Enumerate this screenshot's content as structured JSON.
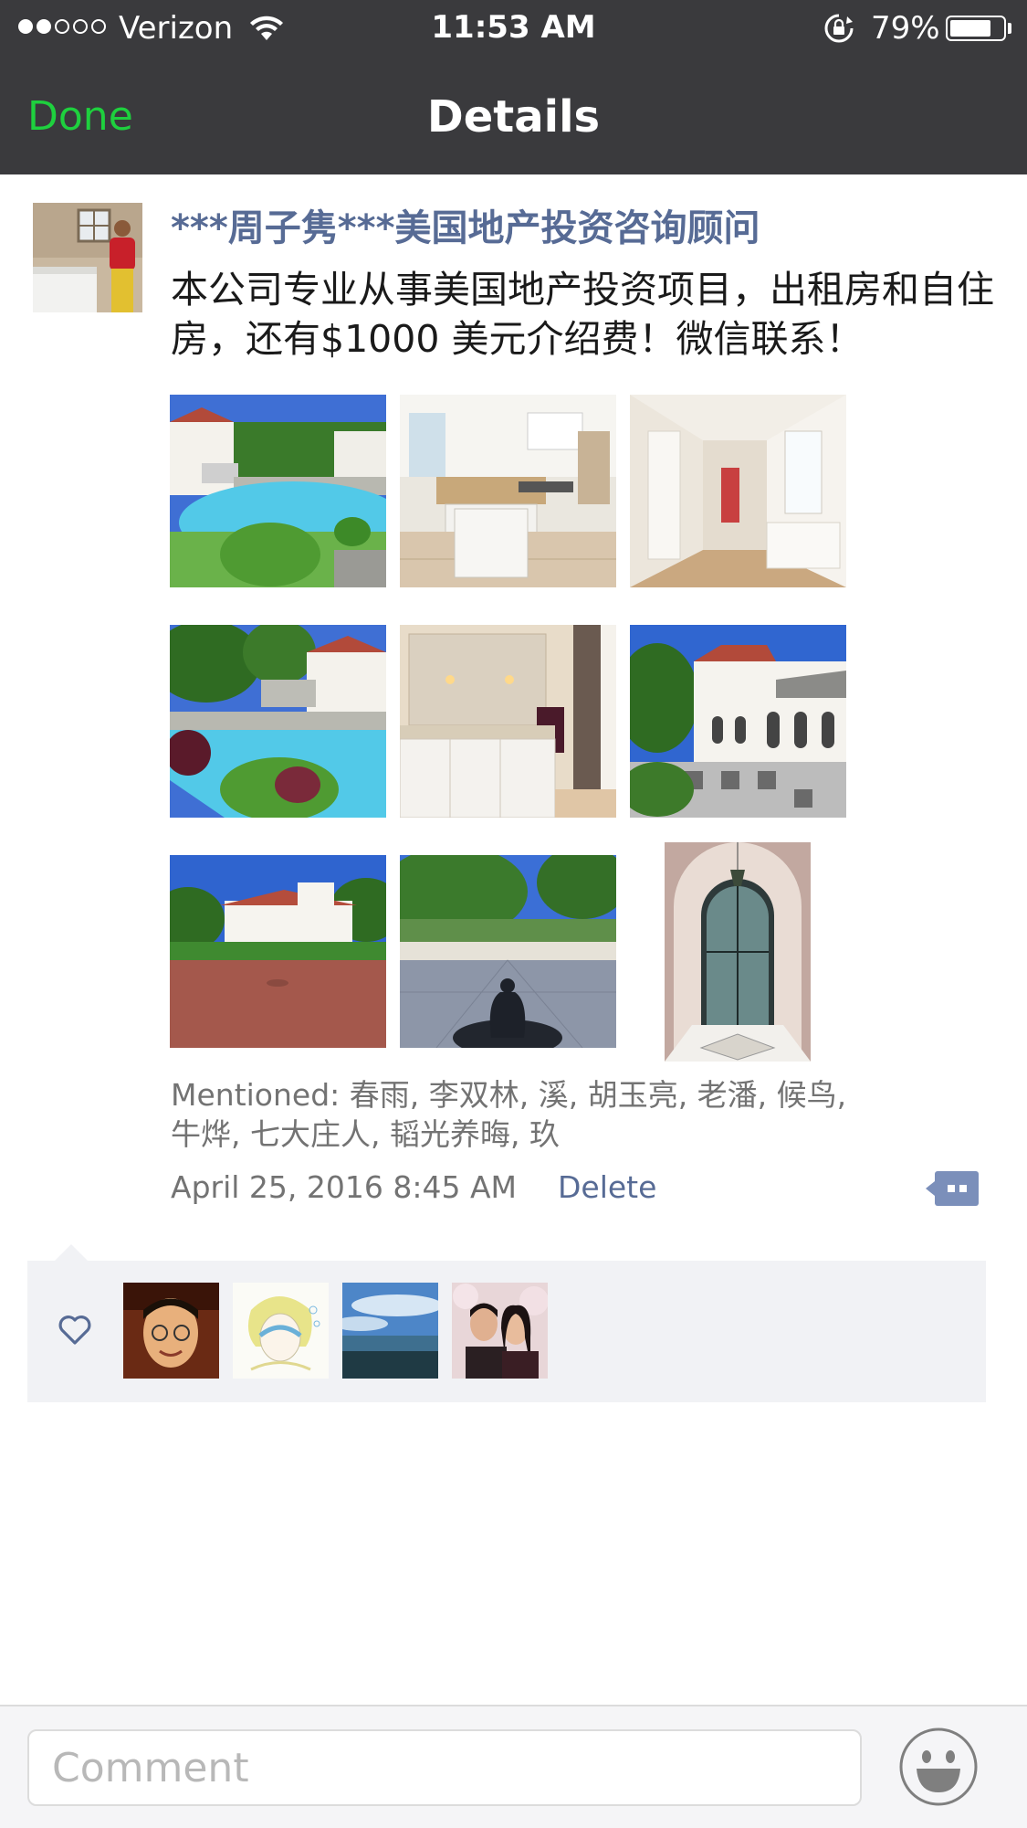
{
  "status_bar": {
    "carrier": "Verizon",
    "time": "11:53 AM",
    "battery_percent": "79%",
    "battery_level": 0.79,
    "signal_bars": 2,
    "signal_total": 5
  },
  "nav": {
    "done_label": "Done",
    "title": "Details"
  },
  "post": {
    "author": "***周子隽***美国地产投资咨询顾问",
    "text": "本公司专业从事美国地产投资项目，出租房和自住房，还有$1000 美元介绍费！微信联系！",
    "photos": [
      {
        "name": "pool-villa-photo"
      },
      {
        "name": "kitchen-photo"
      },
      {
        "name": "hallway-photo"
      },
      {
        "name": "pool-garden-photo"
      },
      {
        "name": "bathroom-photo"
      },
      {
        "name": "villa-patio-photo"
      },
      {
        "name": "villa-driveway-photo"
      },
      {
        "name": "terrace-fountain-photo"
      },
      {
        "name": "arched-doorway-photo"
      }
    ],
    "mentioned": "Mentioned: 春雨, 李双林, 溪, 胡玉亮, 老潘, 候鸟, 牛烨, 七大庄人, 韬光养晦, 玖",
    "date": "April 25, 2016 8:45 AM",
    "delete_label": "Delete"
  },
  "likes": {
    "icon": "heart-icon",
    "avatars": [
      {
        "name": "liker-avatar-man-glasses"
      },
      {
        "name": "liker-avatar-anime-drawing"
      },
      {
        "name": "liker-avatar-sky-landscape"
      },
      {
        "name": "liker-avatar-couple-selfie"
      }
    ]
  },
  "comment_bar": {
    "placeholder": "Comment",
    "emoji_icon": "smiley-icon"
  },
  "colors": {
    "nav_background": "#3a3a3d",
    "done_green": "#1ed03e",
    "link_blue": "#576b95",
    "likes_background": "#f1f2f5"
  }
}
